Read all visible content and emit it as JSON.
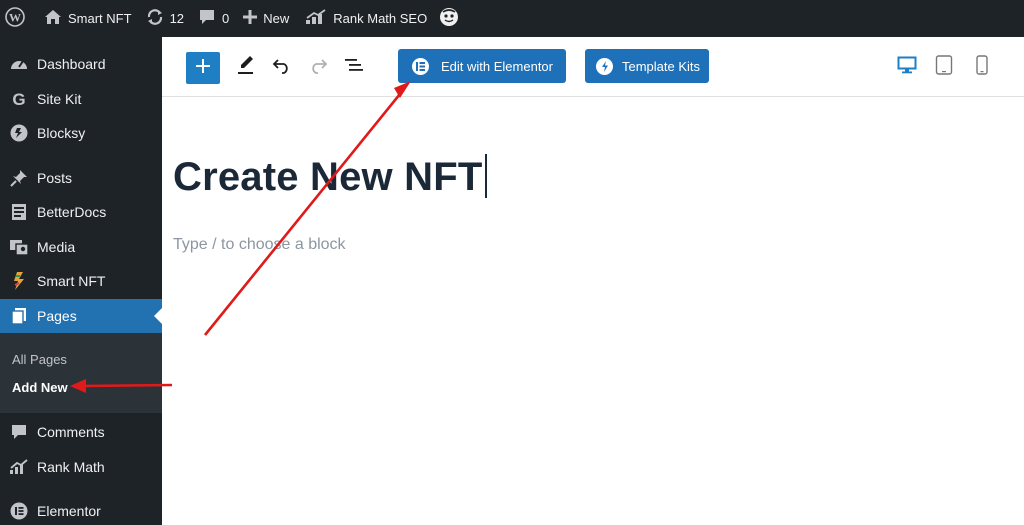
{
  "admin_bar": {
    "site_name": "Smart NFT",
    "updates_count": "12",
    "comments_count": "0",
    "new_label": "New",
    "rank_math_label": "Rank Math SEO"
  },
  "sidebar": {
    "items": [
      {
        "label": "Dashboard",
        "icon": "dashboard-icon"
      },
      {
        "label": "Site Kit",
        "icon": "site-kit-icon"
      },
      {
        "label": "Blocksy",
        "icon": "blocksy-icon"
      },
      {
        "label": "Posts",
        "icon": "pin-icon"
      },
      {
        "label": "BetterDocs",
        "icon": "docs-icon"
      },
      {
        "label": "Media",
        "icon": "media-icon"
      },
      {
        "label": "Smart NFT",
        "icon": "smart-nft-icon"
      },
      {
        "label": "Pages",
        "icon": "pages-icon"
      },
      {
        "label": "Comments",
        "icon": "comment-icon"
      },
      {
        "label": "Rank Math",
        "icon": "rank-math-icon"
      },
      {
        "label": "Elementor",
        "icon": "elementor-icon"
      }
    ],
    "submenu": [
      {
        "label": "All Pages"
      },
      {
        "label": "Add New"
      }
    ]
  },
  "toolbar": {
    "edit_with_elementor": "Edit with Elementor",
    "template_kits": "Template Kits"
  },
  "editor": {
    "title": "Create New NFT",
    "placeholder": "Type / to choose a block"
  },
  "colors": {
    "admin_dark": "#1d2327",
    "accent_blue": "#2271b1",
    "elementor_button": "#1e71b8",
    "annotation_red": "#e01a1a"
  }
}
